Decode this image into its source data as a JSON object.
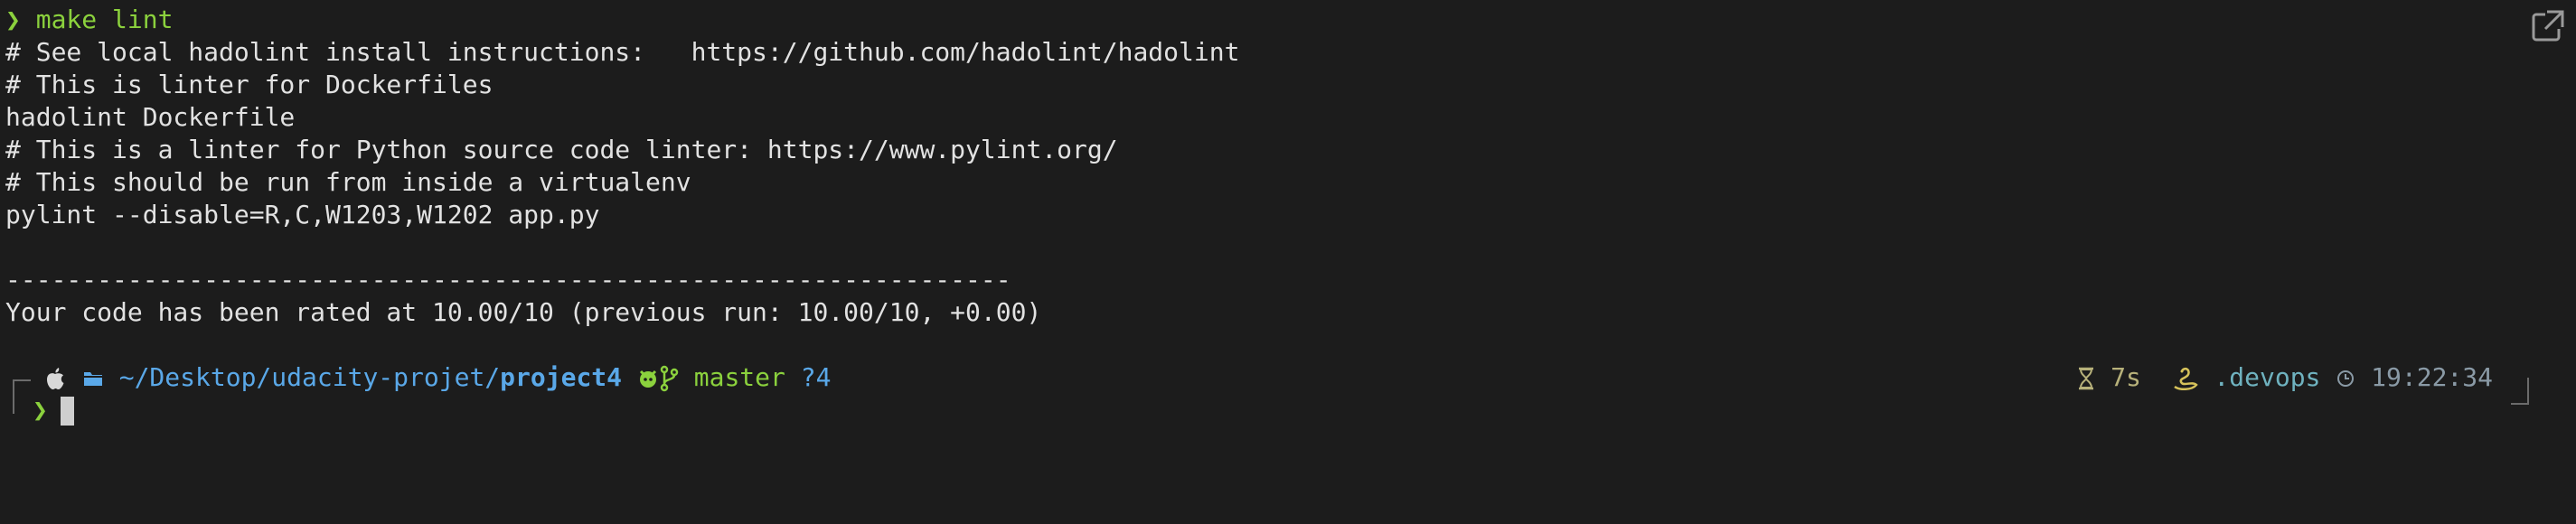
{
  "terminal": {
    "command_prompt": "❯",
    "command": "make lint",
    "output_lines": [
      "# See local hadolint install instructions:   https://github.com/hadolint/hadolint",
      "# This is linter for Dockerfiles",
      "hadolint Dockerfile",
      "# This is a linter for Python source code linter: https://www.pylint.org/",
      "# This should be run from inside a virtualenv",
      "pylint --disable=R,C,W1203,W1202 app.py",
      "",
      "------------------------------------------------------------------",
      "Your code has been rated at 10.00/10 (previous run: 10.00/10, +0.00)"
    ]
  },
  "prompt": {
    "apple_icon": "apple-icon",
    "folder_icon": "folder-icon",
    "path_prefix": "~/Desktop/udacity-projet/",
    "path_current": "project4",
    "github_icon": "github-icon",
    "branch_icon": "git-branch-icon",
    "branch": "master",
    "git_status": "?4",
    "input_prompt": "❯"
  },
  "status": {
    "hourglass_icon": "hourglass-icon",
    "duration": "7s",
    "python_icon": "python-icon",
    "venv": ".devops",
    "clock_icon": "clock-icon",
    "time": "19:22:34"
  },
  "colors": {
    "background": "#1c1c1c",
    "text": "#e2e2e2",
    "accent_green": "#8bd13d",
    "path_blue": "#5aa8e8",
    "status_teal": "#6fb2bf"
  }
}
